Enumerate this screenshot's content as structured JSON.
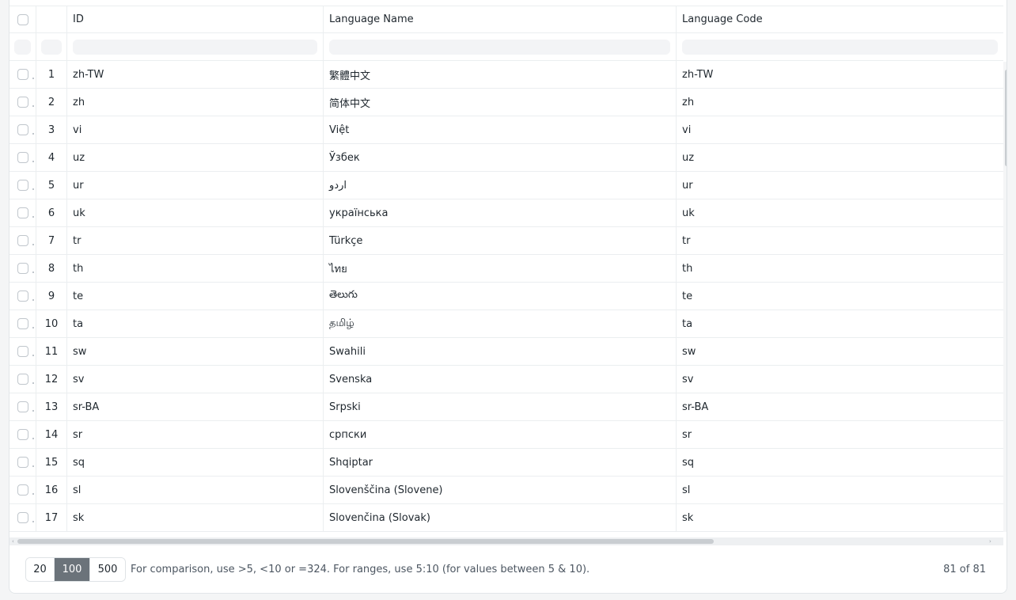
{
  "columns": {
    "id": "ID",
    "name": "Language Name",
    "code": "Language Code"
  },
  "rows": [
    {
      "num": "1",
      "id": "zh-TW",
      "name": "繁體中文",
      "code": "zh-TW"
    },
    {
      "num": "2",
      "id": "zh",
      "name": "简体中文",
      "code": "zh"
    },
    {
      "num": "3",
      "id": "vi",
      "name": "Việt",
      "code": "vi"
    },
    {
      "num": "4",
      "id": "uz",
      "name": "Ўзбек",
      "code": "uz"
    },
    {
      "num": "5",
      "id": "ur",
      "name": "اردو",
      "code": "ur"
    },
    {
      "num": "6",
      "id": "uk",
      "name": "українська",
      "code": "uk"
    },
    {
      "num": "7",
      "id": "tr",
      "name": "Türkçe",
      "code": "tr"
    },
    {
      "num": "8",
      "id": "th",
      "name": "ไทย",
      "code": "th"
    },
    {
      "num": "9",
      "id": "te",
      "name": "తెలుగు",
      "code": "te"
    },
    {
      "num": "10",
      "id": "ta",
      "name": "தமிழ்",
      "code": "ta"
    },
    {
      "num": "11",
      "id": "sw",
      "name": "Swahili",
      "code": "sw"
    },
    {
      "num": "12",
      "id": "sv",
      "name": "Svenska",
      "code": "sv"
    },
    {
      "num": "13",
      "id": "sr-BA",
      "name": "Srpski",
      "code": "sr-BA"
    },
    {
      "num": "14",
      "id": "sr",
      "name": "српски",
      "code": "sr"
    },
    {
      "num": "15",
      "id": "sq",
      "name": "Shqiptar",
      "code": "sq"
    },
    {
      "num": "16",
      "id": "sl",
      "name": "Slovenščina (Slovene)",
      "code": "sl"
    },
    {
      "num": "17",
      "id": "sk",
      "name": "Slovenčina (Slovak)",
      "code": "sk"
    }
  ],
  "footer": {
    "page_sizes": [
      "20",
      "100",
      "500"
    ],
    "selected_page_size": "100",
    "hint": "For comparison, use >5, <10 or =324. For ranges, use 5:10 (for values between 5 & 10).",
    "count": "81 of 81"
  },
  "colors": {
    "selected_page_size_bg": "#6b737a",
    "border": "#ebeef0"
  }
}
